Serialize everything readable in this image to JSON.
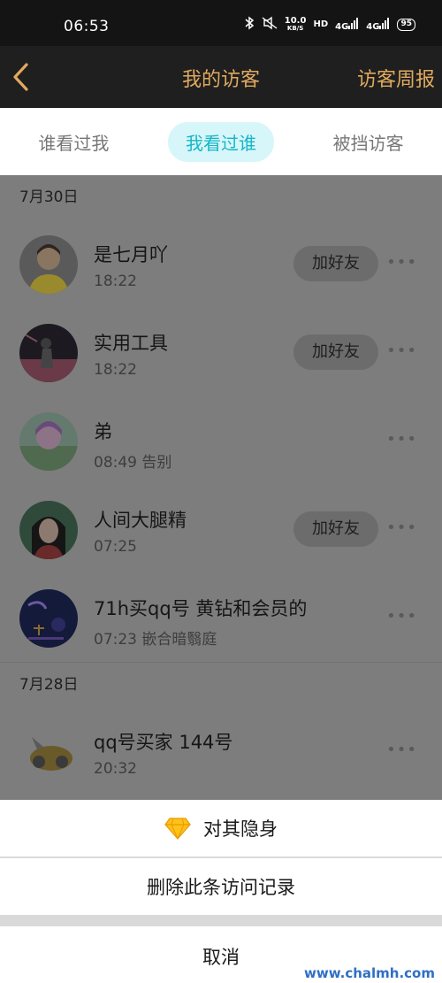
{
  "status_bar": {
    "time": "06:53",
    "speed_value": "10.0",
    "speed_unit": "KB/S",
    "hd": "HD",
    "sig1": "4G",
    "sig2": "4G",
    "battery": "95"
  },
  "nav": {
    "title": "我的访客",
    "right_label": "访客周报",
    "accent": "#e0aa5e"
  },
  "tabs": [
    {
      "label": "谁看过我"
    },
    {
      "label": "我看过谁"
    },
    {
      "label": "被挡访客"
    }
  ],
  "groups": [
    {
      "date": "7月30日",
      "rows": [
        {
          "name": "是七月吖",
          "meta": "18:22",
          "add": "加好友"
        },
        {
          "name": "实用工具",
          "meta": "18:22",
          "add": "加好友"
        },
        {
          "name": "弟",
          "meta": "08:49 告别"
        },
        {
          "name": "人间大腿精",
          "meta": "07:25",
          "add": "加好友"
        },
        {
          "name": "71h买qq号 黄钻和会员的",
          "meta": "07:23 嵌合暗翳庭"
        }
      ]
    },
    {
      "date": "7月28日",
      "rows": [
        {
          "name": "qq号买家 144号",
          "meta": "20:32"
        }
      ]
    }
  ],
  "more_symbol": "•••",
  "sheet": {
    "hide_label": "对其隐身",
    "delete_label": "删除此条访问记录",
    "cancel_label": "取消"
  },
  "watermark": "www.chalmh.com"
}
